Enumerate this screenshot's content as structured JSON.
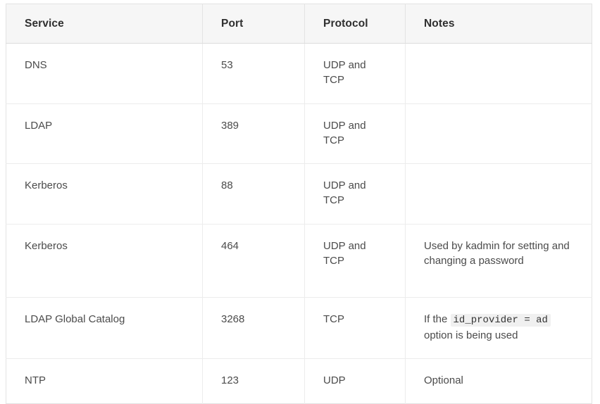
{
  "table": {
    "columns": [
      {
        "key": "service",
        "label": "Service"
      },
      {
        "key": "port",
        "label": "Port"
      },
      {
        "key": "protocol",
        "label": "Protocol"
      },
      {
        "key": "notes",
        "label": "Notes"
      }
    ],
    "rows": [
      {
        "service": "DNS",
        "port": "53",
        "protocol_line1": "UDP and",
        "protocol_line2": "TCP",
        "notes": ""
      },
      {
        "service": "LDAP",
        "port": "389",
        "protocol_line1": "UDP and",
        "protocol_line2": "TCP",
        "notes": ""
      },
      {
        "service": "Kerberos",
        "port": "88",
        "protocol_line1": "UDP and",
        "protocol_line2": "TCP",
        "notes": ""
      },
      {
        "service": "Kerberos",
        "port": "464",
        "protocol_line1": "UDP and",
        "protocol_line2": "TCP",
        "notes": "Used by kadmin for setting and changing a password"
      },
      {
        "service": "LDAP Global Catalog",
        "port": "3268",
        "protocol_line1": "TCP",
        "protocol_line2": "",
        "notes_prefix": "If the ",
        "notes_code": "id_provider = ad",
        "notes_suffix": " option is being used"
      },
      {
        "service": "NTP",
        "port": "123",
        "protocol_line1": "UDP",
        "protocol_line2": "",
        "notes": "Optional"
      }
    ]
  },
  "colors": {
    "header_background": "#f6f6f6",
    "header_text": "#2f2f2f",
    "body_text": "#4b4b4b",
    "border": "#e3e3e3",
    "row_divider": "#ececec",
    "code_background": "#f0f0f0",
    "code_text": "#333333",
    "page_background": "#ffffff"
  }
}
